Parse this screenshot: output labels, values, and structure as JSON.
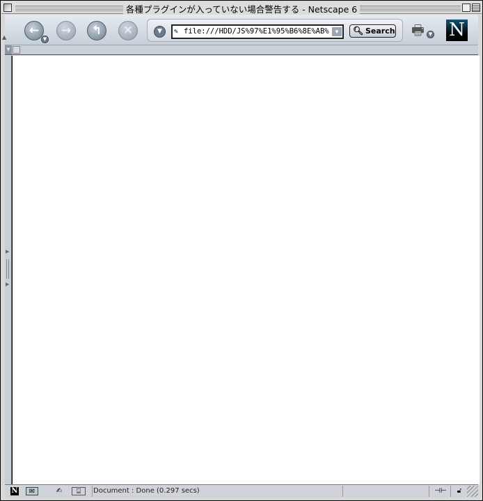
{
  "window": {
    "title": "各種プラグインが入っていない場合警告する - Netscape 6"
  },
  "toolbar": {
    "back_icon": "←",
    "forward_icon": "→",
    "reload_icon": "↰",
    "stop_icon": "✕",
    "url": "file:///HDD/JS%97%E1%95%B6%8E%AB%",
    "search_label": "Search",
    "logo_letter": "N"
  },
  "status": {
    "text": "Document : Done (0.297 secs)"
  }
}
